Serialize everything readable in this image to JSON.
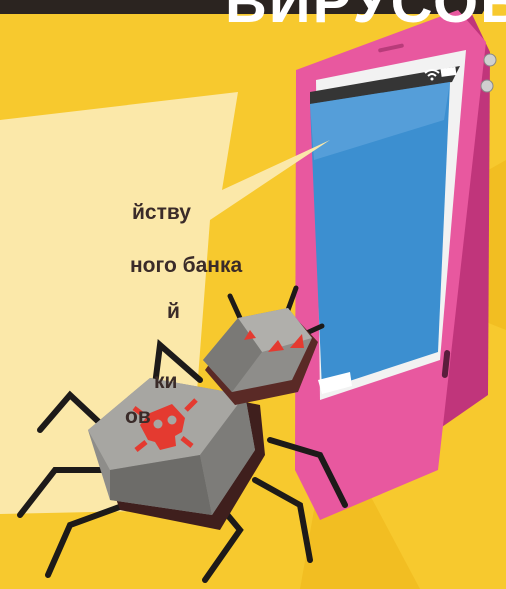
{
  "headline": "ВИРУСОВ",
  "list_fragments": [
    "йству",
    "ного банка",
    "й",
    "ки",
    "ов"
  ],
  "colors": {
    "background": "#f7c92e",
    "phone_body": "#e8589f",
    "phone_screen": "#3c8fd0",
    "speech_bubble": "#fbe8a9",
    "spider_body": "#8e8d8a",
    "skull": "#e43a30"
  },
  "icons": [
    "wifi-icon",
    "battery-icon",
    "skull-icon"
  ]
}
